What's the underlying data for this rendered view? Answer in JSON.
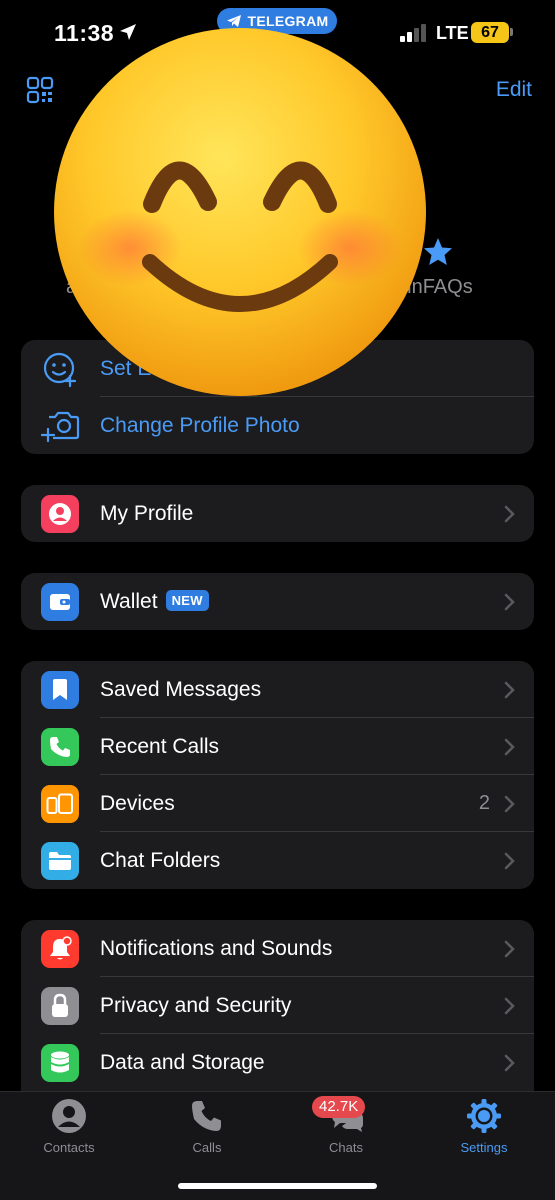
{
  "status_bar": {
    "time": "11:38",
    "app_pill": "TELEGRAM",
    "network": "LTE",
    "battery": "67"
  },
  "top_nav": {
    "edit_label": "Edit",
    "qr_icon": "qr-code-icon"
  },
  "header": {
    "emoji": "smiling-face-icon",
    "partial_left": "a",
    "faq_label": "ainFAQs"
  },
  "profile_actions": [
    {
      "label": "Set E",
      "icon": "emoji-status-icon"
    },
    {
      "label": "Change Profile Photo",
      "icon": "camera-add-icon"
    }
  ],
  "group_profile": [
    {
      "label": "My Profile",
      "icon": "person-icon",
      "color": "#f43f5e"
    }
  ],
  "group_wallet": [
    {
      "label": "Wallet",
      "badge": "NEW",
      "icon": "wallet-icon",
      "color": "#2f7de1"
    }
  ],
  "group_main": [
    {
      "label": "Saved Messages",
      "icon": "bookmark-icon",
      "color": "#2f7de1",
      "value": ""
    },
    {
      "label": "Recent Calls",
      "icon": "phone-icon",
      "color": "#34c759",
      "value": ""
    },
    {
      "label": "Devices",
      "icon": "devices-icon",
      "color": "#ff9500",
      "value": "2"
    },
    {
      "label": "Chat Folders",
      "icon": "folder-icon",
      "color": "#32ade6",
      "value": ""
    }
  ],
  "group_settings": [
    {
      "label": "Notifications and Sounds",
      "icon": "bell-icon",
      "color": "#ff3b30"
    },
    {
      "label": "Privacy and Security",
      "icon": "lock-icon",
      "color": "#8e8e93"
    },
    {
      "label": "Data and Storage",
      "icon": "database-icon",
      "color": "#34c759"
    }
  ],
  "tabbar": {
    "tabs": [
      {
        "label": "Contacts",
        "icon": "contacts-icon"
      },
      {
        "label": "Calls",
        "icon": "phone-icon"
      },
      {
        "label": "Chats",
        "icon": "chats-icon",
        "badge": "42.7K"
      },
      {
        "label": "Settings",
        "icon": "settings-icon",
        "active": true
      }
    ]
  }
}
